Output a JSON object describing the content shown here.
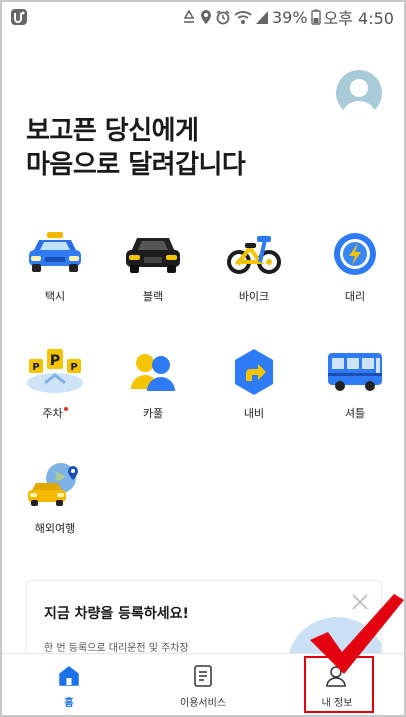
{
  "status_bar": {
    "battery": "39%",
    "time": "오후 4:50",
    "icons": [
      "app-icon",
      "recycle-icon",
      "location-icon",
      "alarm-icon",
      "wifi-icon",
      "signal-icon",
      "battery-icon"
    ]
  },
  "headline": {
    "line1": "보고픈 당신에게",
    "line2": "마음으로 달려갑니다"
  },
  "services": [
    {
      "label": "택시",
      "icon": "taxi-icon",
      "new_dot": false
    },
    {
      "label": "블랙",
      "icon": "black-car-icon",
      "new_dot": false
    },
    {
      "label": "바이크",
      "icon": "bike-icon",
      "new_dot": false
    },
    {
      "label": "대리",
      "icon": "steering-wheel-icon",
      "new_dot": false
    },
    {
      "label": "주차",
      "icon": "parking-icon",
      "new_dot": true
    },
    {
      "label": "카풀",
      "icon": "carpool-icon",
      "new_dot": false
    },
    {
      "label": "내비",
      "icon": "navi-icon",
      "new_dot": false
    },
    {
      "label": "셔틀",
      "icon": "shuttle-bus-icon",
      "new_dot": false
    },
    {
      "label": "해외여행",
      "icon": "overseas-travel-icon",
      "new_dot": false
    }
  ],
  "banner": {
    "title": "지금 차량을 등록하세요!",
    "description": "한 번 등록으로 대리운전 및 주차장"
  },
  "tabbar": {
    "tabs": [
      {
        "label": "홈",
        "icon": "home-icon",
        "active": true
      },
      {
        "label": "이용서비스",
        "icon": "document-icon",
        "active": false
      },
      {
        "label": "내 정보",
        "icon": "person-icon",
        "active": false
      }
    ]
  },
  "colors": {
    "accent": "#1a73e8",
    "taxi_yellow": "#f5b800",
    "annotation_red": "#e3000f"
  }
}
